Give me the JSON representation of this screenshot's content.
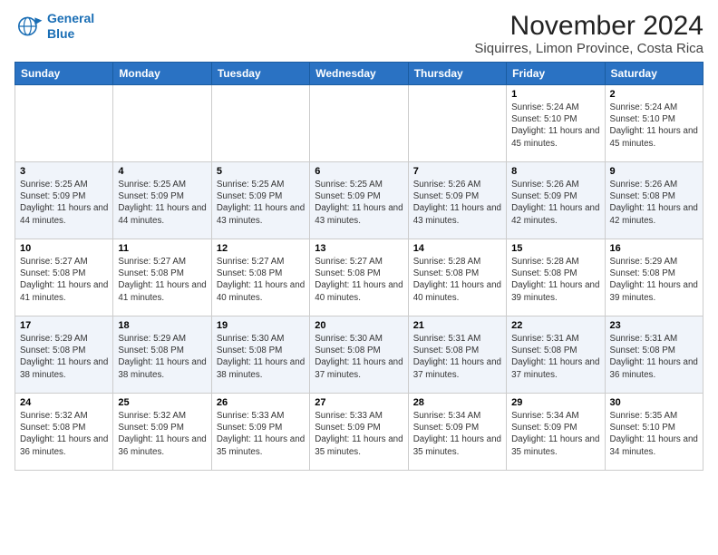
{
  "header": {
    "logo_line1": "General",
    "logo_line2": "Blue",
    "title": "November 2024",
    "subtitle": "Siquirres, Limon Province, Costa Rica"
  },
  "calendar": {
    "days_of_week": [
      "Sunday",
      "Monday",
      "Tuesday",
      "Wednesday",
      "Thursday",
      "Friday",
      "Saturday"
    ],
    "weeks": [
      [
        {
          "day": "",
          "info": ""
        },
        {
          "day": "",
          "info": ""
        },
        {
          "day": "",
          "info": ""
        },
        {
          "day": "",
          "info": ""
        },
        {
          "day": "",
          "info": ""
        },
        {
          "day": "1",
          "info": "Sunrise: 5:24 AM\nSunset: 5:10 PM\nDaylight: 11 hours and 45 minutes."
        },
        {
          "day": "2",
          "info": "Sunrise: 5:24 AM\nSunset: 5:10 PM\nDaylight: 11 hours and 45 minutes."
        }
      ],
      [
        {
          "day": "3",
          "info": "Sunrise: 5:25 AM\nSunset: 5:09 PM\nDaylight: 11 hours and 44 minutes."
        },
        {
          "day": "4",
          "info": "Sunrise: 5:25 AM\nSunset: 5:09 PM\nDaylight: 11 hours and 44 minutes."
        },
        {
          "day": "5",
          "info": "Sunrise: 5:25 AM\nSunset: 5:09 PM\nDaylight: 11 hours and 43 minutes."
        },
        {
          "day": "6",
          "info": "Sunrise: 5:25 AM\nSunset: 5:09 PM\nDaylight: 11 hours and 43 minutes."
        },
        {
          "day": "7",
          "info": "Sunrise: 5:26 AM\nSunset: 5:09 PM\nDaylight: 11 hours and 43 minutes."
        },
        {
          "day": "8",
          "info": "Sunrise: 5:26 AM\nSunset: 5:09 PM\nDaylight: 11 hours and 42 minutes."
        },
        {
          "day": "9",
          "info": "Sunrise: 5:26 AM\nSunset: 5:08 PM\nDaylight: 11 hours and 42 minutes."
        }
      ],
      [
        {
          "day": "10",
          "info": "Sunrise: 5:27 AM\nSunset: 5:08 PM\nDaylight: 11 hours and 41 minutes."
        },
        {
          "day": "11",
          "info": "Sunrise: 5:27 AM\nSunset: 5:08 PM\nDaylight: 11 hours and 41 minutes."
        },
        {
          "day": "12",
          "info": "Sunrise: 5:27 AM\nSunset: 5:08 PM\nDaylight: 11 hours and 40 minutes."
        },
        {
          "day": "13",
          "info": "Sunrise: 5:27 AM\nSunset: 5:08 PM\nDaylight: 11 hours and 40 minutes."
        },
        {
          "day": "14",
          "info": "Sunrise: 5:28 AM\nSunset: 5:08 PM\nDaylight: 11 hours and 40 minutes."
        },
        {
          "day": "15",
          "info": "Sunrise: 5:28 AM\nSunset: 5:08 PM\nDaylight: 11 hours and 39 minutes."
        },
        {
          "day": "16",
          "info": "Sunrise: 5:29 AM\nSunset: 5:08 PM\nDaylight: 11 hours and 39 minutes."
        }
      ],
      [
        {
          "day": "17",
          "info": "Sunrise: 5:29 AM\nSunset: 5:08 PM\nDaylight: 11 hours and 38 minutes."
        },
        {
          "day": "18",
          "info": "Sunrise: 5:29 AM\nSunset: 5:08 PM\nDaylight: 11 hours and 38 minutes."
        },
        {
          "day": "19",
          "info": "Sunrise: 5:30 AM\nSunset: 5:08 PM\nDaylight: 11 hours and 38 minutes."
        },
        {
          "day": "20",
          "info": "Sunrise: 5:30 AM\nSunset: 5:08 PM\nDaylight: 11 hours and 37 minutes."
        },
        {
          "day": "21",
          "info": "Sunrise: 5:31 AM\nSunset: 5:08 PM\nDaylight: 11 hours and 37 minutes."
        },
        {
          "day": "22",
          "info": "Sunrise: 5:31 AM\nSunset: 5:08 PM\nDaylight: 11 hours and 37 minutes."
        },
        {
          "day": "23",
          "info": "Sunrise: 5:31 AM\nSunset: 5:08 PM\nDaylight: 11 hours and 36 minutes."
        }
      ],
      [
        {
          "day": "24",
          "info": "Sunrise: 5:32 AM\nSunset: 5:08 PM\nDaylight: 11 hours and 36 minutes."
        },
        {
          "day": "25",
          "info": "Sunrise: 5:32 AM\nSunset: 5:09 PM\nDaylight: 11 hours and 36 minutes."
        },
        {
          "day": "26",
          "info": "Sunrise: 5:33 AM\nSunset: 5:09 PM\nDaylight: 11 hours and 35 minutes."
        },
        {
          "day": "27",
          "info": "Sunrise: 5:33 AM\nSunset: 5:09 PM\nDaylight: 11 hours and 35 minutes."
        },
        {
          "day": "28",
          "info": "Sunrise: 5:34 AM\nSunset: 5:09 PM\nDaylight: 11 hours and 35 minutes."
        },
        {
          "day": "29",
          "info": "Sunrise: 5:34 AM\nSunset: 5:09 PM\nDaylight: 11 hours and 35 minutes."
        },
        {
          "day": "30",
          "info": "Sunrise: 5:35 AM\nSunset: 5:10 PM\nDaylight: 11 hours and 34 minutes."
        }
      ]
    ]
  }
}
